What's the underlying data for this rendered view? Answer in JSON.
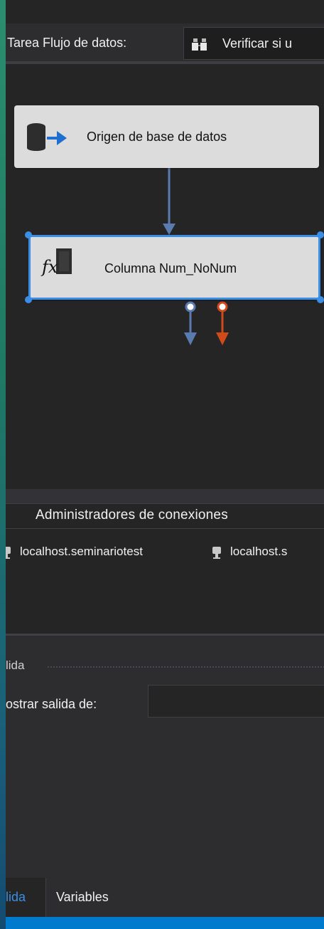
{
  "toolbar": {
    "task_label": "Tarea Flujo de datos:",
    "task_value": "Verificar si u"
  },
  "canvas": {
    "source_node_label": "Origen de base de datos",
    "transform_node_label": "Columna Num_NoNum",
    "transform_icon_text": "fx",
    "colors": {
      "selected_border": "#3b8ee6",
      "path_default": "#5a7bb0",
      "path_error": "#d04a1a"
    }
  },
  "connections": {
    "title": "Administradores de conexiones",
    "items": [
      {
        "label": "localhost.seminariotest"
      },
      {
        "label": "localhost.s"
      }
    ]
  },
  "output": {
    "title": "lida",
    "show_label": "ostrar salida de:",
    "show_value": ""
  },
  "tabs": [
    {
      "label": "lida"
    },
    {
      "label": "Variables"
    }
  ]
}
